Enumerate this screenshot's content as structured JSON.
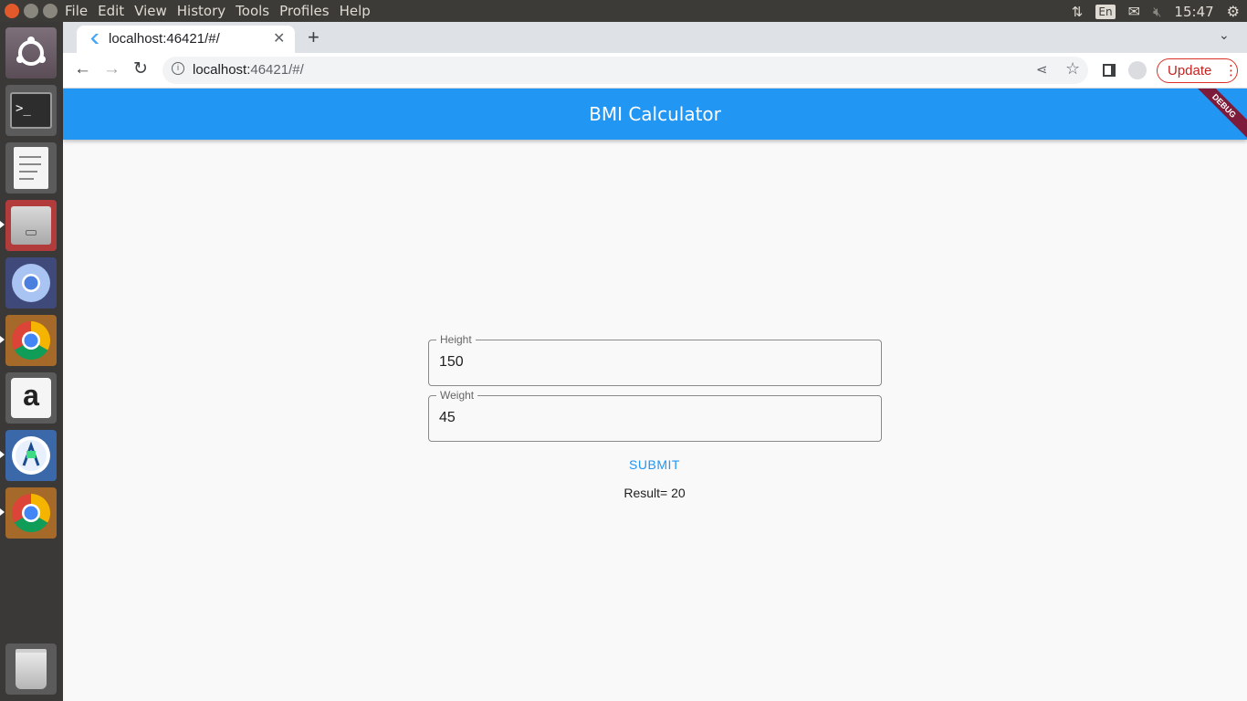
{
  "system": {
    "menu": [
      "File",
      "Edit",
      "View",
      "History",
      "Tools",
      "Profiles",
      "Help"
    ],
    "language": "En",
    "clock": "15:47"
  },
  "browser": {
    "tab_title": "localhost:46421/#/",
    "url_host": "localhost:",
    "url_rest": "46421/#/",
    "update_label": "Update"
  },
  "app": {
    "title": "BMI Calculator",
    "debug_banner": "DEBUG",
    "height_label": "Height",
    "height_value": "150",
    "weight_label": "Weight",
    "weight_value": "45",
    "submit_label": "SUBMIT",
    "result_text": "Result= 20"
  },
  "colors": {
    "appbar": "#2196f3",
    "accent": "#2196f3",
    "debug_banner": "#7d1b3a"
  },
  "launcher_icons": [
    "ubuntu-dash-icon",
    "terminal-icon",
    "text-editor-icon",
    "files-icon",
    "chromium-icon",
    "chrome-icon",
    "amazon-icon",
    "android-studio-icon",
    "chrome-icon",
    "trash-icon"
  ]
}
